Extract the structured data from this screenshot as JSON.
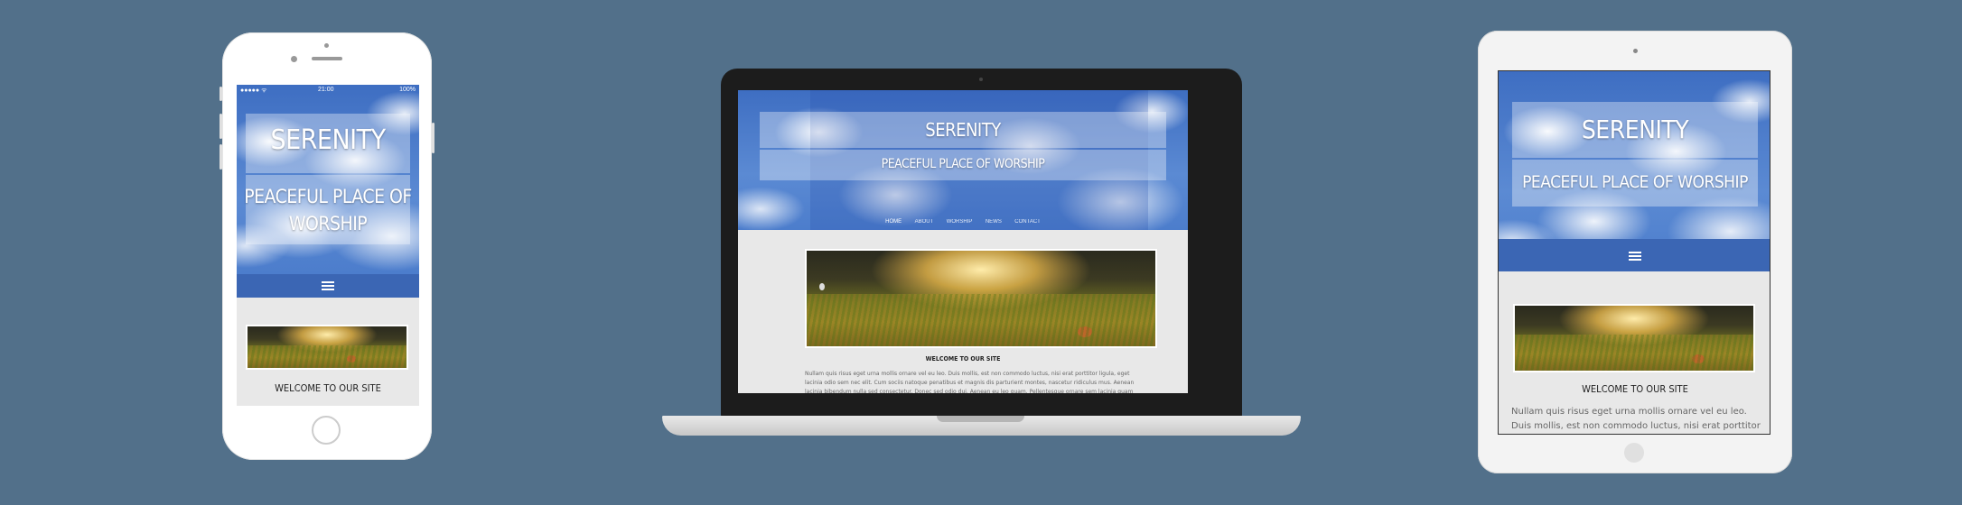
{
  "site": {
    "title": "SERENITY",
    "subtitle": "PEACEFUL PLACE OF WORSHIP",
    "subtitle_line1": "PEACEFUL PLACE OF",
    "subtitle_line2": "WORSHIP",
    "welcome": "WELCOME TO OUR SITE",
    "nav": [
      "HOME",
      "ABOUT",
      "WORSHIP",
      "NEWS",
      "CONTACT"
    ],
    "laptop_body": "Nullam quis risus eget urna mollis ornare vel eu leo. Duis mollis, est non commodo luctus, nisi erat porttitor ligula, eget lacinia odio sem nec elit. Cum sociis natoque penatibus et magnis dis parturient montes, nascetur ridiculus mus. Aenean lacinia bibendum nulla sed consectetur. Donec sed odio dui. Aenean eu leo quam. Pellentesque ornare sem lacinia quam venenatis vestibulum.",
    "tablet_body": "Nullam quis risus eget urna mollis ornare vel eu leo. Duis mollis, est non commodo luctus, nisi erat porttitor ligula, eget lacinia"
  },
  "phone_status": {
    "carrier": "●●●●● ᯤ",
    "time": "21:00",
    "battery": "100%"
  },
  "colors": {
    "background": "#52708a",
    "hero_blue": "#4c7dcc",
    "nav_bar": "#3b66b4"
  },
  "icons": {
    "menu": "hamburger-icon",
    "home_button": "home-button-icon",
    "camera": "camera-icon"
  }
}
